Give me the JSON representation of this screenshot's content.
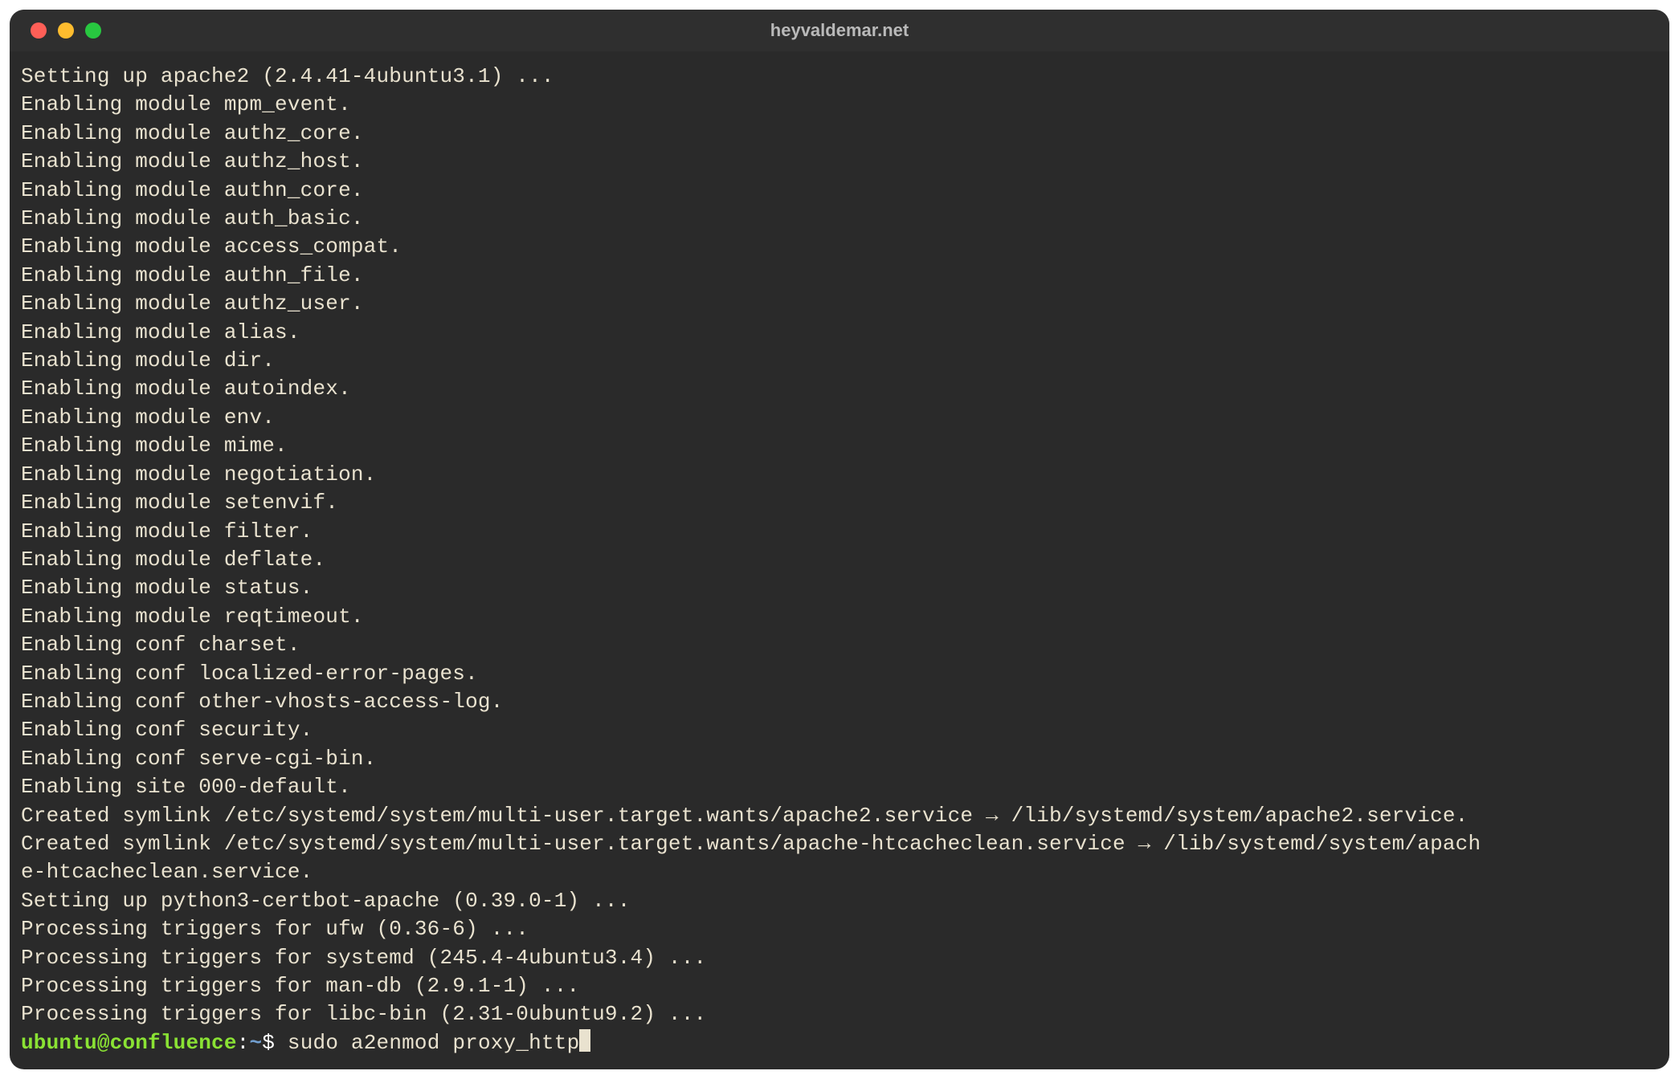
{
  "window": {
    "title": "heyvaldemar.net"
  },
  "colors": {
    "window_bg": "#2a2a2a",
    "titlebar_bg": "#2f2f2f",
    "text": "#e9e2cf",
    "prompt_user": "#8ae234",
    "prompt_path": "#729fcf",
    "close": "#ff5f57",
    "minimize": "#febc2e",
    "zoom": "#28c840"
  },
  "output_lines": [
    "Setting up apache2 (2.4.41-4ubuntu3.1) ...",
    "Enabling module mpm_event.",
    "Enabling module authz_core.",
    "Enabling module authz_host.",
    "Enabling module authn_core.",
    "Enabling module auth_basic.",
    "Enabling module access_compat.",
    "Enabling module authn_file.",
    "Enabling module authz_user.",
    "Enabling module alias.",
    "Enabling module dir.",
    "Enabling module autoindex.",
    "Enabling module env.",
    "Enabling module mime.",
    "Enabling module negotiation.",
    "Enabling module setenvif.",
    "Enabling module filter.",
    "Enabling module deflate.",
    "Enabling module status.",
    "Enabling module reqtimeout.",
    "Enabling conf charset.",
    "Enabling conf localized-error-pages.",
    "Enabling conf other-vhosts-access-log.",
    "Enabling conf security.",
    "Enabling conf serve-cgi-bin.",
    "Enabling site 000-default.",
    "Created symlink /etc/systemd/system/multi-user.target.wants/apache2.service → /lib/systemd/system/apache2.service.",
    "Created symlink /etc/systemd/system/multi-user.target.wants/apache-htcacheclean.service → /lib/systemd/system/apache-htcacheclean.service.",
    "Setting up python3-certbot-apache (0.39.0-1) ...",
    "Processing triggers for ufw (0.36-6) ...",
    "Processing triggers for systemd (245.4-4ubuntu3.4) ...",
    "Processing triggers for man-db (2.9.1-1) ...",
    "Processing triggers for libc-bin (2.31-0ubuntu9.2) ..."
  ],
  "prompt": {
    "user": "ubuntu",
    "at": "@",
    "host": "confluence",
    "colon": ":",
    "path": "~",
    "sigil": "$",
    "command": " sudo a2enmod proxy_http"
  }
}
